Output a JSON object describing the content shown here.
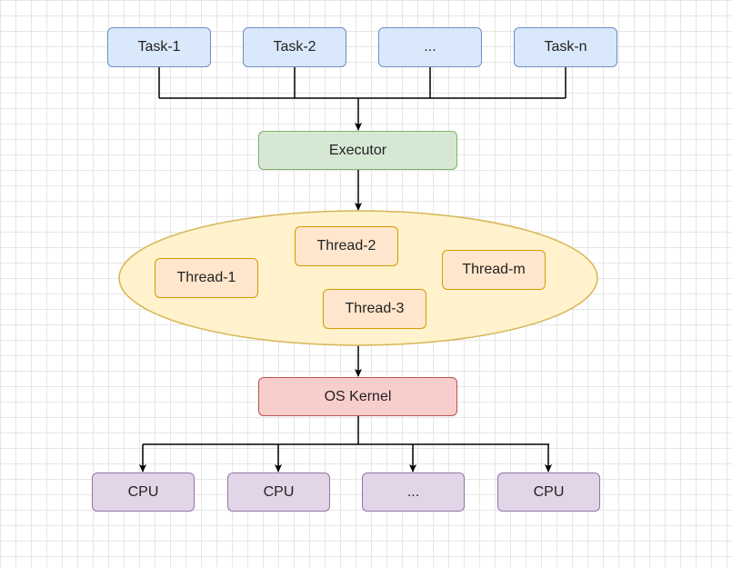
{
  "tasks": [
    "Task-1",
    "Task-2",
    "...",
    "Task-n"
  ],
  "executor": "Executor",
  "threads": [
    "Thread-1",
    "Thread-2",
    "Thread-3",
    "Thread-m"
  ],
  "kernel": "OS Kernel",
  "cpus": [
    "CPU",
    "CPU",
    "...",
    "CPU"
  ],
  "colors": {
    "task_fill": "#dae8fc",
    "task_stroke": "#6c8ebf",
    "executor_fill": "#d5e8d4",
    "executor_stroke": "#82b366",
    "pool_fill": "#fff2cc",
    "pool_stroke": "#d6b656",
    "thread_fill": "#ffe6cc",
    "thread_stroke": "#d79b00",
    "kernel_fill": "#f8cecc",
    "kernel_stroke": "#b85450",
    "cpu_fill": "#e1d5e7",
    "cpu_stroke": "#9673a6"
  }
}
